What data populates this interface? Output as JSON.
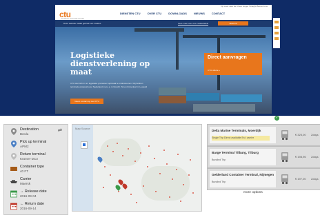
{
  "website": {
    "utility_text": "Op zoek naar de Cheer Hoger Straight Bezoek ons",
    "logo": "ctu",
    "logo_tagline": "container terminal utrecht",
    "nav": [
      "DIENSTEN CTU",
      "OVER CTU",
      "DOWNLOADS",
      "NIEUWS",
      "CONTACT"
    ],
    "info_text": "Deze website maakt gebruik van cookies",
    "info_link": "Lees meer over ons cookiebeleid",
    "info_button": "Akkoord",
    "hero_title": "Logistieke dienstverlening op maat",
    "hero_text": "CTU stel zich in om logistieke processen optimaal te ondersteunen. Wij hebben terminals verspreid over Nederland met o.a. in Utrecht. Tel en binnenkort in Leopold",
    "hero_button": "Neem contact op met CTU",
    "cta_title": "Direct aanvragen",
    "cta_sub": "CTU offerte »",
    "accent": "#e8761c"
  },
  "filters": [
    {
      "icon": "location-pin-icon",
      "label": "Destination",
      "value": "Breda",
      "color": "#8a8a8a"
    },
    {
      "icon": "location-pin-icon",
      "label": "Pick up terminal",
      "value": "APM2",
      "color": "#4a7fc4"
    },
    {
      "icon": "location-pin-icon",
      "label": "Return terminal",
      "value": "Kramer-DC3",
      "color": "#c7c7c7"
    },
    {
      "icon": "container-icon",
      "label": "Container type",
      "value": "40 FT",
      "color": "#b5651d"
    },
    {
      "icon": "ship-icon",
      "label": "Carrier",
      "value": "Maersk",
      "color": "#444444"
    },
    {
      "icon": "calendar-icon",
      "label": "→ Release date",
      "value": "2016-09-04",
      "color": "#3a9a4a"
    },
    {
      "icon": "calendar-icon",
      "label": "← Return date",
      "value": "2016-09-14",
      "color": "#c0392b"
    }
  ],
  "map": {
    "label": "Map Source"
  },
  "results": [
    {
      "title": "Delta Marine Terminals, Moerdijk",
      "meta": "Single Trip   Direct available   Est. carrier",
      "price": "€ 325,00",
      "days": "2days",
      "highlight": true
    },
    {
      "title": "Barge Terminal Tilburg, Tilburg",
      "meta": "Bundled Trip",
      "price": "€ 198,96",
      "days": "2days",
      "highlight": false
    },
    {
      "title": "Gelderland Container Terminal, Nijmegen",
      "meta": "Bundled Trip",
      "price": "€ 197,00",
      "days": "2days",
      "highlight": false
    }
  ],
  "more_options": "more options"
}
